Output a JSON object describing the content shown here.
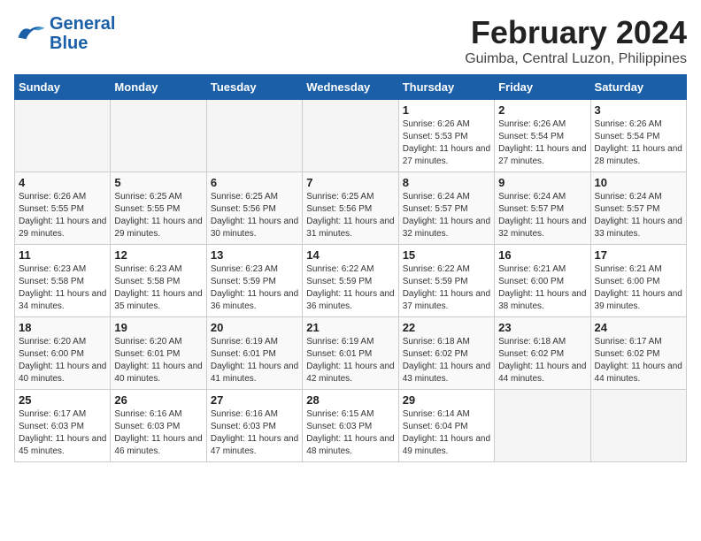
{
  "header": {
    "logo_line1": "General",
    "logo_line2": "Blue",
    "title": "February 2024",
    "location": "Guimba, Central Luzon, Philippines"
  },
  "days_of_week": [
    "Sunday",
    "Monday",
    "Tuesday",
    "Wednesday",
    "Thursday",
    "Friday",
    "Saturday"
  ],
  "weeks": [
    [
      {
        "day": "",
        "info": ""
      },
      {
        "day": "",
        "info": ""
      },
      {
        "day": "",
        "info": ""
      },
      {
        "day": "",
        "info": ""
      },
      {
        "day": "1",
        "info": "Sunrise: 6:26 AM\nSunset: 5:53 PM\nDaylight: 11 hours and 27 minutes."
      },
      {
        "day": "2",
        "info": "Sunrise: 6:26 AM\nSunset: 5:54 PM\nDaylight: 11 hours and 27 minutes."
      },
      {
        "day": "3",
        "info": "Sunrise: 6:26 AM\nSunset: 5:54 PM\nDaylight: 11 hours and 28 minutes."
      }
    ],
    [
      {
        "day": "4",
        "info": "Sunrise: 6:26 AM\nSunset: 5:55 PM\nDaylight: 11 hours and 29 minutes."
      },
      {
        "day": "5",
        "info": "Sunrise: 6:25 AM\nSunset: 5:55 PM\nDaylight: 11 hours and 29 minutes."
      },
      {
        "day": "6",
        "info": "Sunrise: 6:25 AM\nSunset: 5:56 PM\nDaylight: 11 hours and 30 minutes."
      },
      {
        "day": "7",
        "info": "Sunrise: 6:25 AM\nSunset: 5:56 PM\nDaylight: 11 hours and 31 minutes."
      },
      {
        "day": "8",
        "info": "Sunrise: 6:24 AM\nSunset: 5:57 PM\nDaylight: 11 hours and 32 minutes."
      },
      {
        "day": "9",
        "info": "Sunrise: 6:24 AM\nSunset: 5:57 PM\nDaylight: 11 hours and 32 minutes."
      },
      {
        "day": "10",
        "info": "Sunrise: 6:24 AM\nSunset: 5:57 PM\nDaylight: 11 hours and 33 minutes."
      }
    ],
    [
      {
        "day": "11",
        "info": "Sunrise: 6:23 AM\nSunset: 5:58 PM\nDaylight: 11 hours and 34 minutes."
      },
      {
        "day": "12",
        "info": "Sunrise: 6:23 AM\nSunset: 5:58 PM\nDaylight: 11 hours and 35 minutes."
      },
      {
        "day": "13",
        "info": "Sunrise: 6:23 AM\nSunset: 5:59 PM\nDaylight: 11 hours and 36 minutes."
      },
      {
        "day": "14",
        "info": "Sunrise: 6:22 AM\nSunset: 5:59 PM\nDaylight: 11 hours and 36 minutes."
      },
      {
        "day": "15",
        "info": "Sunrise: 6:22 AM\nSunset: 5:59 PM\nDaylight: 11 hours and 37 minutes."
      },
      {
        "day": "16",
        "info": "Sunrise: 6:21 AM\nSunset: 6:00 PM\nDaylight: 11 hours and 38 minutes."
      },
      {
        "day": "17",
        "info": "Sunrise: 6:21 AM\nSunset: 6:00 PM\nDaylight: 11 hours and 39 minutes."
      }
    ],
    [
      {
        "day": "18",
        "info": "Sunrise: 6:20 AM\nSunset: 6:00 PM\nDaylight: 11 hours and 40 minutes."
      },
      {
        "day": "19",
        "info": "Sunrise: 6:20 AM\nSunset: 6:01 PM\nDaylight: 11 hours and 40 minutes."
      },
      {
        "day": "20",
        "info": "Sunrise: 6:19 AM\nSunset: 6:01 PM\nDaylight: 11 hours and 41 minutes."
      },
      {
        "day": "21",
        "info": "Sunrise: 6:19 AM\nSunset: 6:01 PM\nDaylight: 11 hours and 42 minutes."
      },
      {
        "day": "22",
        "info": "Sunrise: 6:18 AM\nSunset: 6:02 PM\nDaylight: 11 hours and 43 minutes."
      },
      {
        "day": "23",
        "info": "Sunrise: 6:18 AM\nSunset: 6:02 PM\nDaylight: 11 hours and 44 minutes."
      },
      {
        "day": "24",
        "info": "Sunrise: 6:17 AM\nSunset: 6:02 PM\nDaylight: 11 hours and 44 minutes."
      }
    ],
    [
      {
        "day": "25",
        "info": "Sunrise: 6:17 AM\nSunset: 6:03 PM\nDaylight: 11 hours and 45 minutes."
      },
      {
        "day": "26",
        "info": "Sunrise: 6:16 AM\nSunset: 6:03 PM\nDaylight: 11 hours and 46 minutes."
      },
      {
        "day": "27",
        "info": "Sunrise: 6:16 AM\nSunset: 6:03 PM\nDaylight: 11 hours and 47 minutes."
      },
      {
        "day": "28",
        "info": "Sunrise: 6:15 AM\nSunset: 6:03 PM\nDaylight: 11 hours and 48 minutes."
      },
      {
        "day": "29",
        "info": "Sunrise: 6:14 AM\nSunset: 6:04 PM\nDaylight: 11 hours and 49 minutes."
      },
      {
        "day": "",
        "info": ""
      },
      {
        "day": "",
        "info": ""
      }
    ]
  ]
}
